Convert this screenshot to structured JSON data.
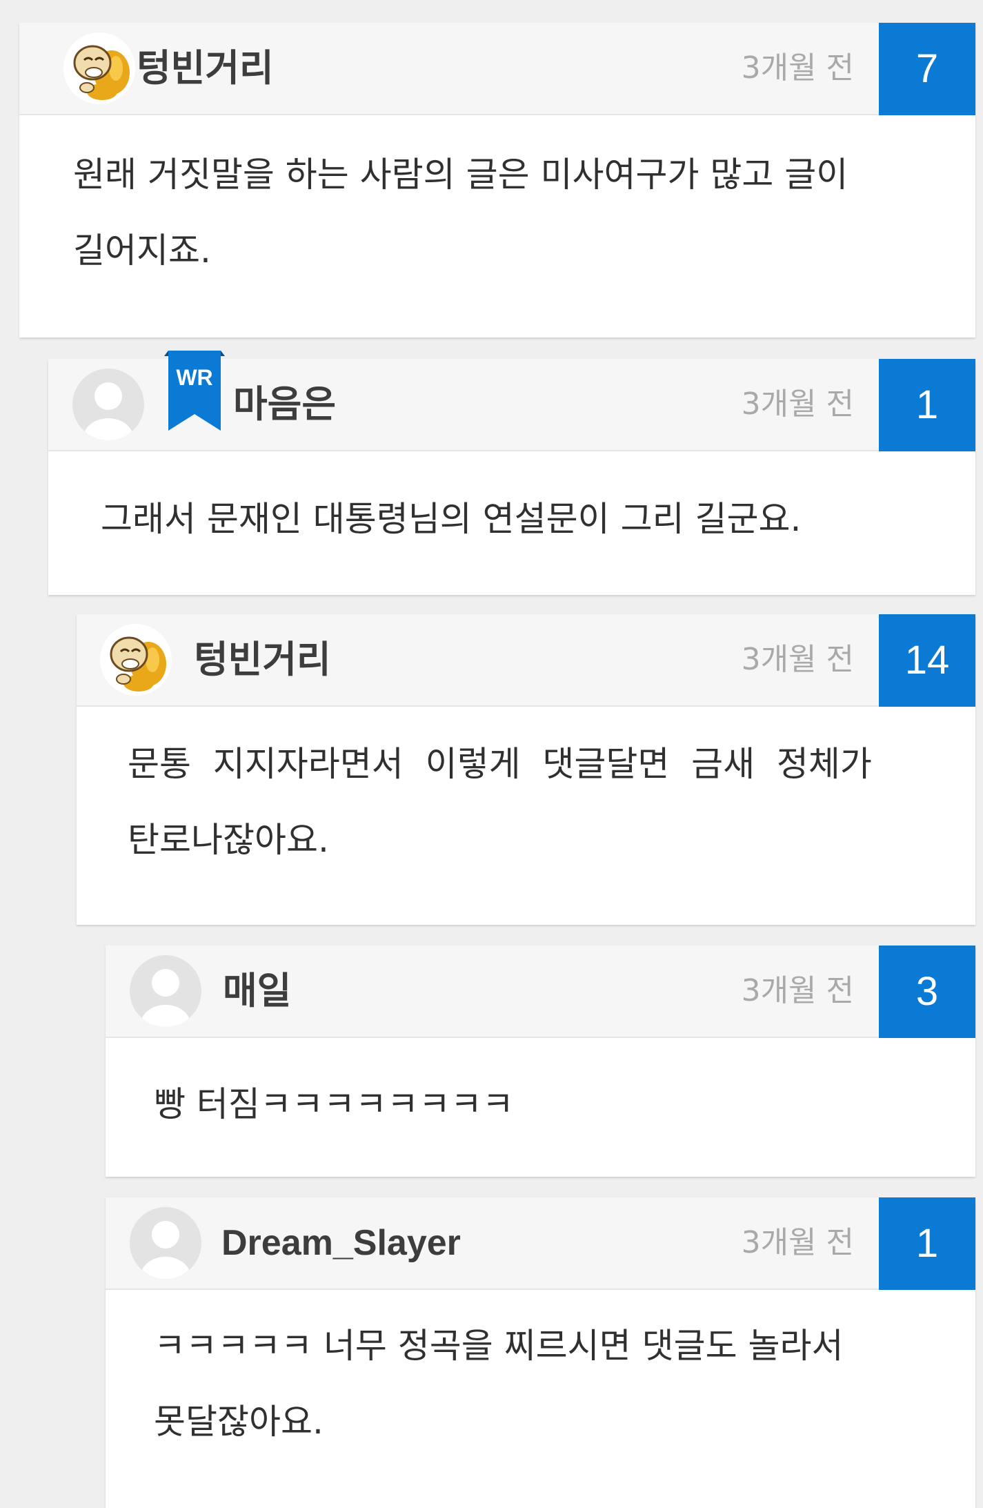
{
  "comments": [
    {
      "username": "텅빈거리",
      "time": "3개월 전",
      "votes": "7",
      "text_lines": [
        "원래 거짓말을 하는 사람의 글은 미사여구가 많고 글이",
        "길어지죠."
      ]
    },
    {
      "username": "마음은",
      "badge": "WR",
      "time": "3개월 전",
      "votes": "1",
      "text": "그래서 문재인 대통령님의 연설문이 그리 길군요."
    },
    {
      "username": "텅빈거리",
      "time": "3개월 전",
      "votes": "14",
      "text_lines": [
        "문통  지지자라면서  이렇게  댓글달면  금새  정체가",
        "탄로나잖아요."
      ]
    },
    {
      "username": "매일",
      "time": "3개월 전",
      "votes": "3",
      "text": "빵 터짐ㅋㅋㅋㅋㅋㅋㅋㅋ"
    },
    {
      "username": "Dream_Slayer",
      "time": "3개월 전",
      "votes": "1",
      "text_lines": [
        "ㅋㅋㅋㅋㅋ 너무 정곡을 찌르시면 댓글도 놀라서",
        "못달잖아요."
      ]
    }
  ],
  "colors": {
    "vote_box": "#0a7ad4",
    "writer_badge": "#0a7ad4",
    "header_bg": "#f6f6f6",
    "page_bg": "#efefef"
  },
  "icons": {
    "mascot_avatar": "monk-mascot-icon",
    "default_avatar": "default-user-icon",
    "writer_badge": "ribbon-bookmark-icon"
  }
}
